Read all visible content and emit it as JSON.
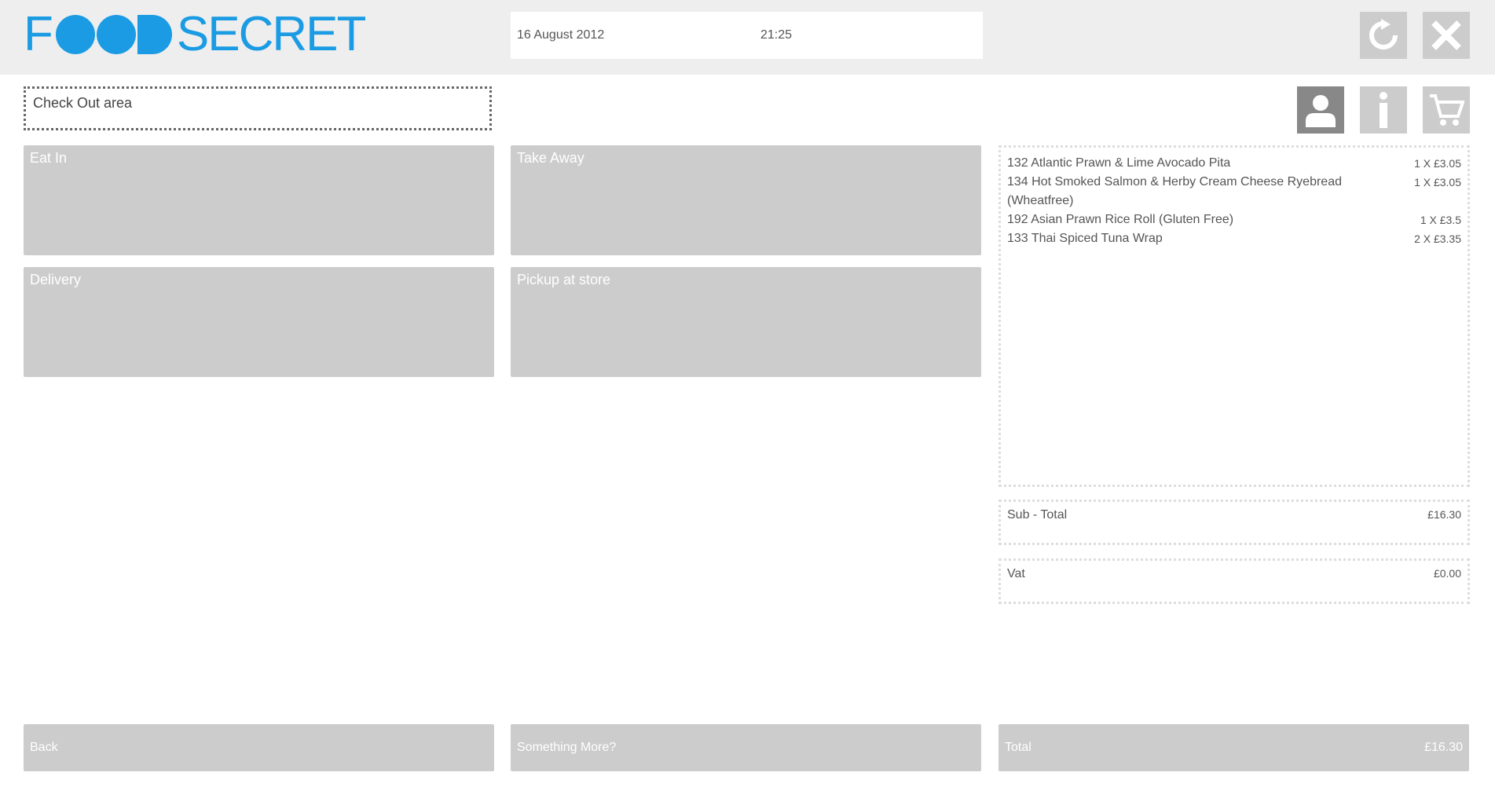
{
  "header": {
    "logo_text": "FOODSECRET",
    "date": "16 August 2012",
    "time": "21:25",
    "icons": [
      "refresh-icon",
      "close-icon"
    ]
  },
  "checkout_area_label": "Check Out area",
  "toolbar_icons": [
    "user-icon",
    "info-icon",
    "cart-icon"
  ],
  "options": [
    {
      "label": "Eat In"
    },
    {
      "label": "Take Away"
    },
    {
      "label": "Delivery"
    },
    {
      "label": "Pickup at store"
    }
  ],
  "order": {
    "items": [
      {
        "name": "132 Atlantic Prawn & Lime Avocado Pita",
        "qty": "1 X £3.05"
      },
      {
        "name": "134 Hot Smoked Salmon & Herby Cream Cheese Ryebread (Wheatfree)",
        "qty": "1 X £3.05"
      },
      {
        "name": "192 Asian Prawn Rice Roll (Gluten Free)",
        "qty": "1 X £3.5"
      },
      {
        "name": "133 Thai Spiced Tuna Wrap",
        "qty": "2 X £3.35"
      }
    ],
    "subtotal_label": "Sub - Total",
    "subtotal_value": "£16.30",
    "vat_label": "Vat",
    "vat_value": "£0.00"
  },
  "footer": {
    "back_label": "Back",
    "more_label": "Something More?",
    "total_label": "Total",
    "total_value": "£16.30"
  },
  "colors": {
    "brand": "#1a9be3",
    "tile": "#cccccc",
    "topbar": "#eeeeee",
    "active_icon": "#888888"
  }
}
